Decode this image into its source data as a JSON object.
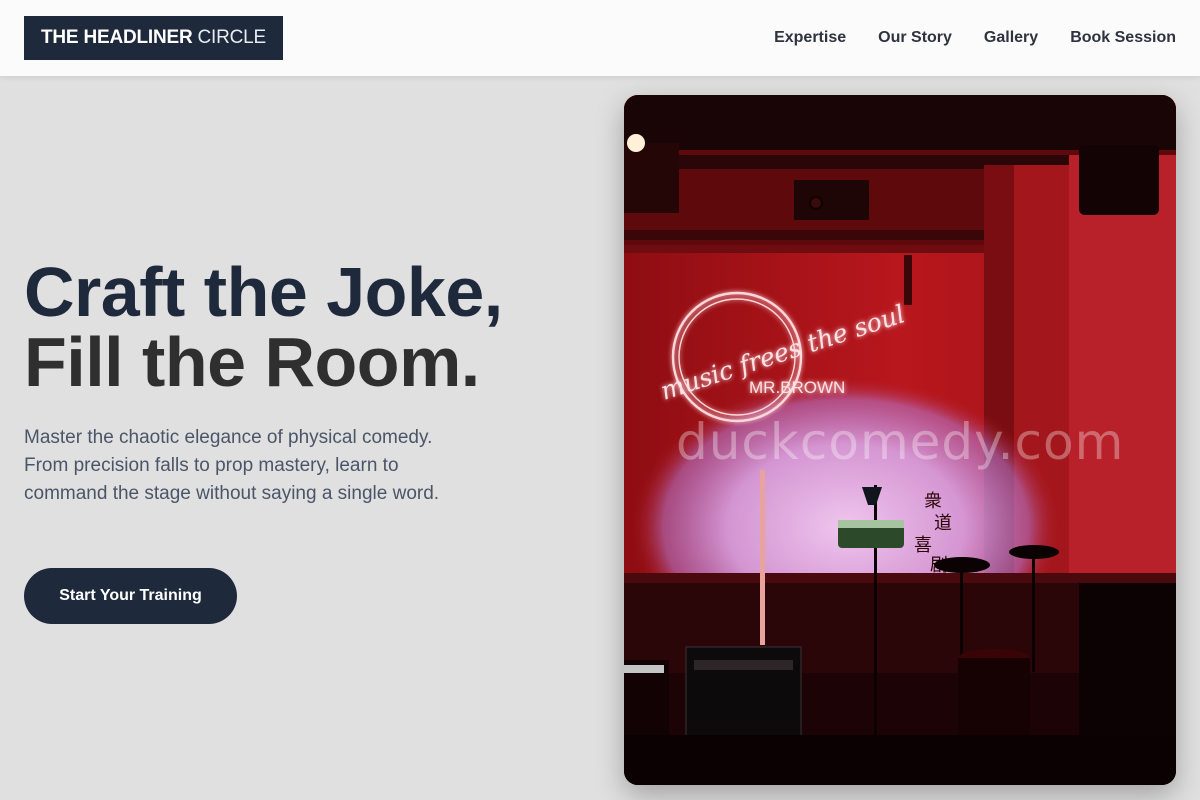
{
  "header": {
    "logo_bold": "THE HEADLINER",
    "logo_light": "CIRCLE",
    "nav": [
      {
        "label": "Expertise"
      },
      {
        "label": "Our Story"
      },
      {
        "label": "Gallery"
      },
      {
        "label": "Book Session"
      }
    ]
  },
  "hero": {
    "title_line1": "Craft the Joke,",
    "title_line2": "Fill the Room.",
    "description": "Master the chaotic elegance of physical comedy. From precision falls to prop mastery, learn to command the stage without saying a single word.",
    "cta_label": "Start Your Training",
    "image": {
      "neon_script": "music frees the soul",
      "neon_sign": "MR.BROWN",
      "watermark": "duckcomedy.com",
      "alt": "Comedy club stage lit in red with neon sign"
    }
  },
  "colors": {
    "primary": "#1e293b",
    "page_bg": "#e0e0e0",
    "header_bg": "#fbfbfb",
    "text_muted": "#4a5568",
    "stage_red": "#b3161c"
  }
}
